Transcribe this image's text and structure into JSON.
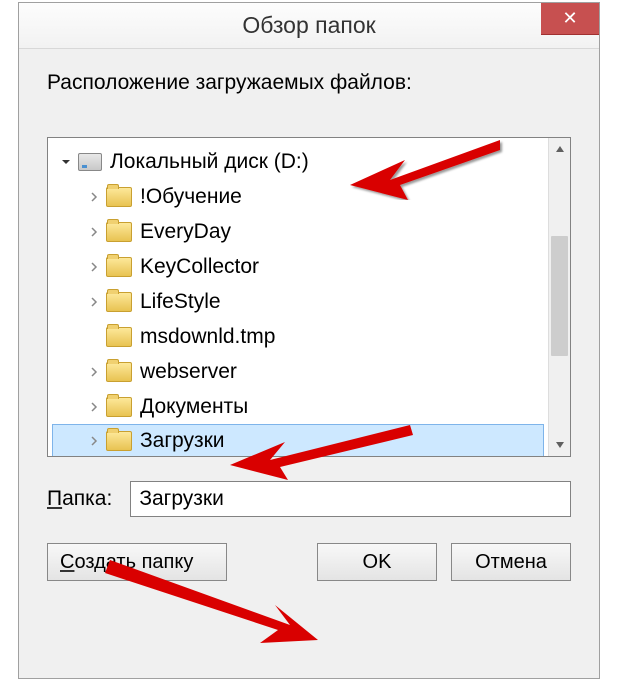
{
  "window": {
    "title": "Обзор папок",
    "close_glyph": "✕"
  },
  "prompt": "Расположение загружаемых файлов:",
  "tree": {
    "root": {
      "label": "Локальный диск (D:)",
      "expanded": true
    },
    "items": [
      {
        "label": "!Обучение",
        "has_children": true
      },
      {
        "label": "EveryDay",
        "has_children": true
      },
      {
        "label": "KeyCollector",
        "has_children": true
      },
      {
        "label": "LifeStyle",
        "has_children": true
      },
      {
        "label": "msdownld.tmp",
        "has_children": false
      },
      {
        "label": "webserver",
        "has_children": true
      },
      {
        "label": "Документы",
        "has_children": true
      },
      {
        "label": "Загрузки",
        "has_children": true,
        "selected": true
      }
    ]
  },
  "folder_field": {
    "label": "Папка:",
    "value": "Загрузки"
  },
  "buttons": {
    "create": "Создать папку",
    "ok": "OK",
    "cancel": "Отмена"
  },
  "colors": {
    "close_bg": "#c75050",
    "selection_bg": "#cde8ff",
    "arrow": "#d90000"
  }
}
